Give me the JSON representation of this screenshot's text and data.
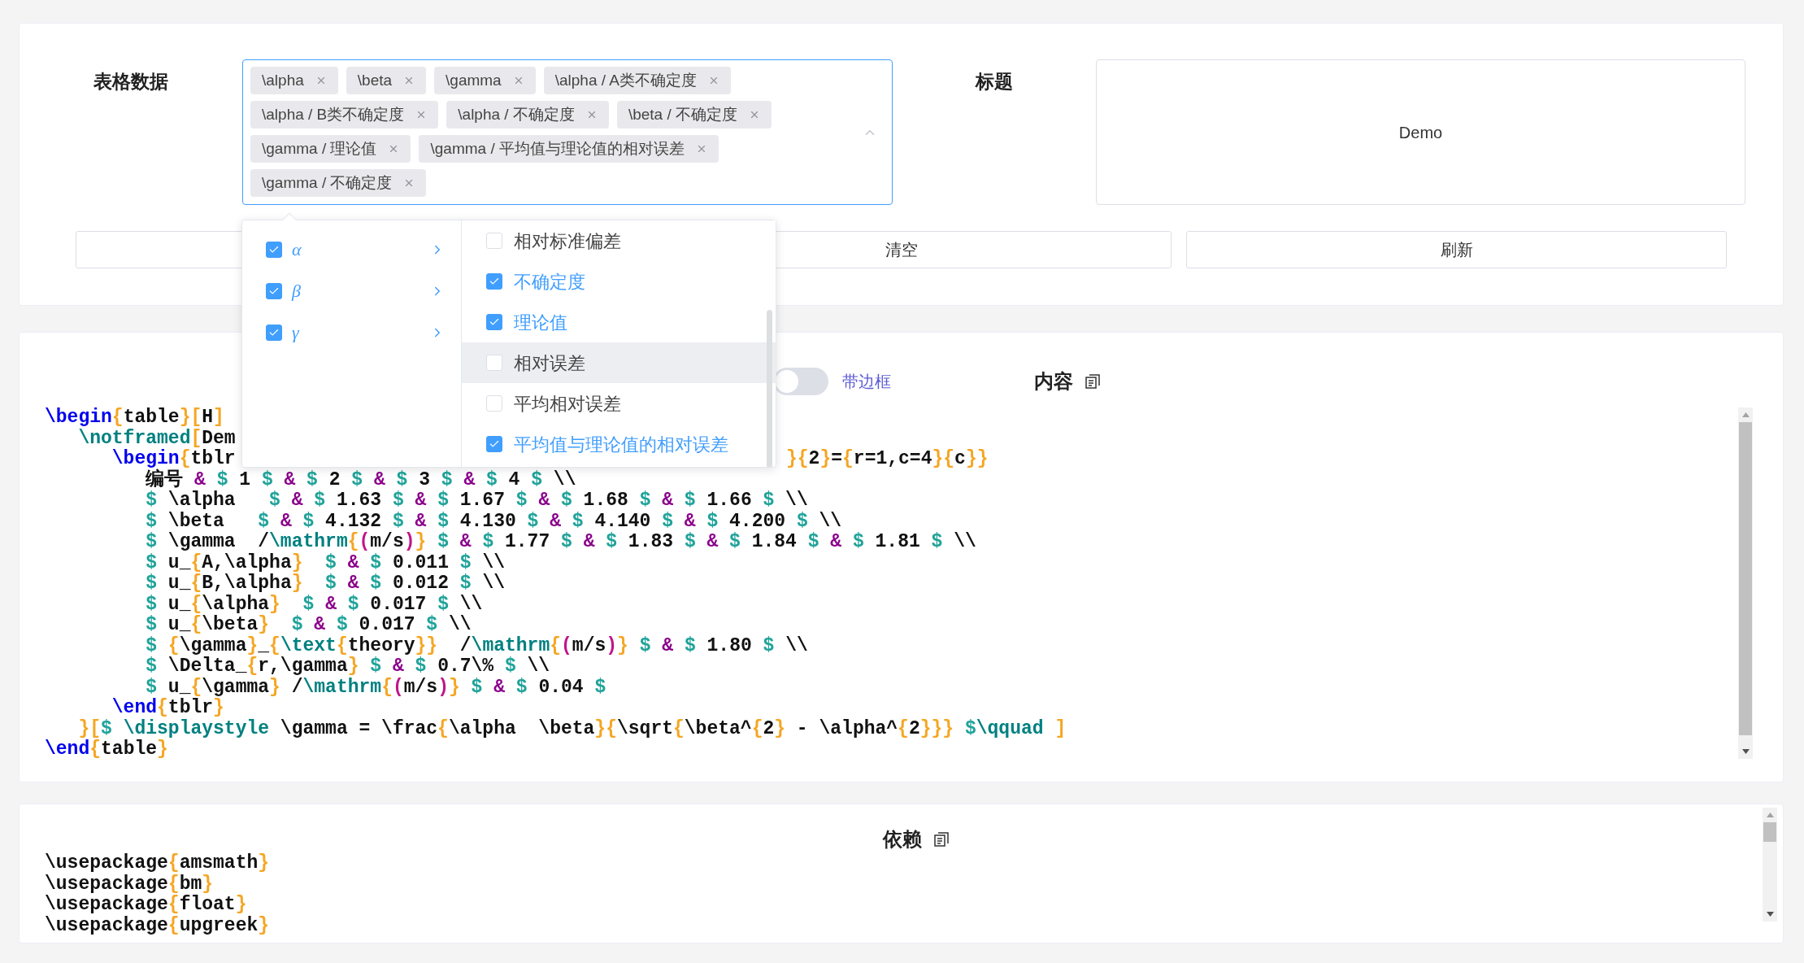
{
  "form": {
    "table_data": {
      "label": "表格数据",
      "tags": [
        "\\alpha",
        "\\beta",
        "\\gamma",
        "\\alpha / A类不确定度",
        "\\alpha / B类不确定度",
        "\\alpha / 不确定度",
        "\\beta / 不确定度",
        "\\gamma / 理论值",
        "\\gamma / 平均值与理论值的相对误差",
        "\\gamma / 不确定度"
      ]
    },
    "title": {
      "label": "标题",
      "value": "Demo"
    },
    "buttons": [
      {
        "label": "清空"
      },
      {
        "label": "刷新"
      }
    ]
  },
  "cascader": {
    "options": [
      {
        "label": "α",
        "checked": true
      },
      {
        "label": "β",
        "checked": true
      },
      {
        "label": "γ",
        "checked": true
      }
    ],
    "sub_options": [
      {
        "label": "相对标准偏差",
        "checked": false,
        "highlighted": false
      },
      {
        "label": "不确定度",
        "checked": true,
        "highlighted": false
      },
      {
        "label": "理论值",
        "checked": true,
        "highlighted": false
      },
      {
        "label": "相对误差",
        "checked": false,
        "highlighted": true
      },
      {
        "label": "平均相对误差",
        "checked": false,
        "highlighted": false
      },
      {
        "label": "平均值与理论值的相对误差",
        "checked": true,
        "highlighted": false
      }
    ]
  },
  "content": {
    "border_toggle": {
      "label": "带边框",
      "on": false
    },
    "heading": "内容",
    "lines": [
      {
        "segments": [
          {
            "kind": "keyword",
            "text": "\\begin"
          },
          {
            "kind": "brace",
            "text": "{"
          },
          {
            "kind": "plain",
            "text": "table"
          },
          {
            "kind": "brace",
            "text": "}["
          },
          {
            "kind": "plain",
            "text": "H"
          },
          {
            "kind": "brace",
            "text": "]"
          }
        ]
      },
      {
        "segments": [
          {
            "kind": "macro",
            "text": "   \\notframed"
          },
          {
            "kind": "brace",
            "text": "["
          },
          {
            "kind": "plain",
            "text": "Dem"
          }
        ]
      },
      {
        "segments": [
          {
            "kind": "keyword",
            "text": "      \\begin"
          },
          {
            "kind": "brace",
            "text": "{"
          },
          {
            "kind": "plain",
            "text": "tblr"
          }
        ],
        "tail": [
          {
            "kind": "brace",
            "text": "}{"
          },
          {
            "kind": "plain",
            "text": "2"
          },
          {
            "kind": "brace",
            "text": "}"
          },
          {
            "kind": "plain",
            "text": "="
          },
          {
            "kind": "brace",
            "text": "{"
          },
          {
            "kind": "plain",
            "text": "r=1,c=4"
          },
          {
            "kind": "brace",
            "text": "}{"
          },
          {
            "kind": "plain",
            "text": "c"
          },
          {
            "kind": "brace",
            "text": "}}"
          }
        ]
      },
      {
        "segments": [
          {
            "kind": "plain",
            "text": "         编号 "
          },
          {
            "kind": "amp",
            "text": "& "
          },
          {
            "kind": "dollar",
            "text": "$"
          },
          {
            "kind": "plain",
            "text": " 1 "
          },
          {
            "kind": "dollar",
            "text": "$ "
          },
          {
            "kind": "amp",
            "text": "& "
          },
          {
            "kind": "dollar",
            "text": "$"
          },
          {
            "kind": "plain",
            "text": " 2 "
          },
          {
            "kind": "dollar",
            "text": "$ "
          },
          {
            "kind": "amp",
            "text": "& "
          },
          {
            "kind": "dollar",
            "text": "$"
          },
          {
            "kind": "plain",
            "text": " 3 "
          },
          {
            "kind": "dollar",
            "text": "$ "
          },
          {
            "kind": "amp",
            "text": "& "
          },
          {
            "kind": "dollar",
            "text": "$"
          },
          {
            "kind": "plain",
            "text": " 4 "
          },
          {
            "kind": "dollar",
            "text": "$"
          },
          {
            "kind": "plain",
            "text": " \\\\"
          }
        ]
      },
      {
        "segments": [
          {
            "kind": "dollar",
            "text": "         $"
          },
          {
            "kind": "plain",
            "text": " \\alpha   "
          },
          {
            "kind": "dollar",
            "text": "$ "
          },
          {
            "kind": "amp",
            "text": "& "
          },
          {
            "kind": "dollar",
            "text": "$"
          },
          {
            "kind": "plain",
            "text": " 1.63 "
          },
          {
            "kind": "dollar",
            "text": "$ "
          },
          {
            "kind": "amp",
            "text": "& "
          },
          {
            "kind": "dollar",
            "text": "$"
          },
          {
            "kind": "plain",
            "text": " 1.67 "
          },
          {
            "kind": "dollar",
            "text": "$ "
          },
          {
            "kind": "amp",
            "text": "& "
          },
          {
            "kind": "dollar",
            "text": "$"
          },
          {
            "kind": "plain",
            "text": " 1.68 "
          },
          {
            "kind": "dollar",
            "text": "$ "
          },
          {
            "kind": "amp",
            "text": "& "
          },
          {
            "kind": "dollar",
            "text": "$"
          },
          {
            "kind": "plain",
            "text": " 1.66 "
          },
          {
            "kind": "dollar",
            "text": "$"
          },
          {
            "kind": "plain",
            "text": " \\\\"
          }
        ]
      },
      {
        "segments": [
          {
            "kind": "dollar",
            "text": "         $"
          },
          {
            "kind": "plain",
            "text": " \\beta   "
          },
          {
            "kind": "dollar",
            "text": "$ "
          },
          {
            "kind": "amp",
            "text": "& "
          },
          {
            "kind": "dollar",
            "text": "$"
          },
          {
            "kind": "plain",
            "text": " 4.132 "
          },
          {
            "kind": "dollar",
            "text": "$ "
          },
          {
            "kind": "amp",
            "text": "& "
          },
          {
            "kind": "dollar",
            "text": "$"
          },
          {
            "kind": "plain",
            "text": " 4.130 "
          },
          {
            "kind": "dollar",
            "text": "$ "
          },
          {
            "kind": "amp",
            "text": "& "
          },
          {
            "kind": "dollar",
            "text": "$"
          },
          {
            "kind": "plain",
            "text": " 4.140 "
          },
          {
            "kind": "dollar",
            "text": "$ "
          },
          {
            "kind": "amp",
            "text": "& "
          },
          {
            "kind": "dollar",
            "text": "$"
          },
          {
            "kind": "plain",
            "text": " 4.200 "
          },
          {
            "kind": "dollar",
            "text": "$"
          },
          {
            "kind": "plain",
            "text": " \\\\"
          }
        ]
      },
      {
        "segments": [
          {
            "kind": "dollar",
            "text": "         $"
          },
          {
            "kind": "plain",
            "text": " \\gamma  /"
          },
          {
            "kind": "macro",
            "text": "\\mathrm"
          },
          {
            "kind": "brace",
            "text": "{"
          },
          {
            "kind": "paren",
            "text": "("
          },
          {
            "kind": "plain",
            "text": "m/s"
          },
          {
            "kind": "paren",
            "text": ")"
          },
          {
            "kind": "brace",
            "text": "} "
          },
          {
            "kind": "dollar",
            "text": "$ "
          },
          {
            "kind": "amp",
            "text": "& "
          },
          {
            "kind": "dollar",
            "text": "$"
          },
          {
            "kind": "plain",
            "text": " 1.77 "
          },
          {
            "kind": "dollar",
            "text": "$ "
          },
          {
            "kind": "amp",
            "text": "& "
          },
          {
            "kind": "dollar",
            "text": "$"
          },
          {
            "kind": "plain",
            "text": " 1.83 "
          },
          {
            "kind": "dollar",
            "text": "$ "
          },
          {
            "kind": "amp",
            "text": "& "
          },
          {
            "kind": "dollar",
            "text": "$"
          },
          {
            "kind": "plain",
            "text": " 1.84 "
          },
          {
            "kind": "dollar",
            "text": "$ "
          },
          {
            "kind": "amp",
            "text": "& "
          },
          {
            "kind": "dollar",
            "text": "$"
          },
          {
            "kind": "plain",
            "text": " 1.81 "
          },
          {
            "kind": "dollar",
            "text": "$"
          },
          {
            "kind": "plain",
            "text": " \\\\"
          }
        ]
      },
      {
        "segments": [
          {
            "kind": "dollar",
            "text": "         $"
          },
          {
            "kind": "plain",
            "text": " u_"
          },
          {
            "kind": "brace",
            "text": "{"
          },
          {
            "kind": "plain",
            "text": "A,\\alpha"
          },
          {
            "kind": "brace",
            "text": "}  "
          },
          {
            "kind": "dollar",
            "text": "$ "
          },
          {
            "kind": "amp",
            "text": "& "
          },
          {
            "kind": "dollar",
            "text": "$"
          },
          {
            "kind": "plain",
            "text": " 0.011 "
          },
          {
            "kind": "dollar",
            "text": "$"
          },
          {
            "kind": "plain",
            "text": " \\\\"
          }
        ]
      },
      {
        "segments": [
          {
            "kind": "dollar",
            "text": "         $"
          },
          {
            "kind": "plain",
            "text": " u_"
          },
          {
            "kind": "brace",
            "text": "{"
          },
          {
            "kind": "plain",
            "text": "B,\\alpha"
          },
          {
            "kind": "brace",
            "text": "}  "
          },
          {
            "kind": "dollar",
            "text": "$ "
          },
          {
            "kind": "amp",
            "text": "& "
          },
          {
            "kind": "dollar",
            "text": "$"
          },
          {
            "kind": "plain",
            "text": " 0.012 "
          },
          {
            "kind": "dollar",
            "text": "$"
          },
          {
            "kind": "plain",
            "text": " \\\\"
          }
        ]
      },
      {
        "segments": [
          {
            "kind": "dollar",
            "text": "         $"
          },
          {
            "kind": "plain",
            "text": " u_"
          },
          {
            "kind": "brace",
            "text": "{"
          },
          {
            "kind": "plain",
            "text": "\\alpha"
          },
          {
            "kind": "brace",
            "text": "}  "
          },
          {
            "kind": "dollar",
            "text": "$ "
          },
          {
            "kind": "amp",
            "text": "& "
          },
          {
            "kind": "dollar",
            "text": "$"
          },
          {
            "kind": "plain",
            "text": " 0.017 "
          },
          {
            "kind": "dollar",
            "text": "$"
          },
          {
            "kind": "plain",
            "text": " \\\\"
          }
        ]
      },
      {
        "segments": [
          {
            "kind": "dollar",
            "text": "         $"
          },
          {
            "kind": "plain",
            "text": " u_"
          },
          {
            "kind": "brace",
            "text": "{"
          },
          {
            "kind": "plain",
            "text": "\\beta"
          },
          {
            "kind": "brace",
            "text": "}  "
          },
          {
            "kind": "dollar",
            "text": "$ "
          },
          {
            "kind": "amp",
            "text": "& "
          },
          {
            "kind": "dollar",
            "text": "$"
          },
          {
            "kind": "plain",
            "text": " 0.017 "
          },
          {
            "kind": "dollar",
            "text": "$"
          },
          {
            "kind": "plain",
            "text": " \\\\"
          }
        ]
      },
      {
        "segments": [
          {
            "kind": "dollar",
            "text": "         $ "
          },
          {
            "kind": "brace",
            "text": "{"
          },
          {
            "kind": "plain",
            "text": "\\gamma"
          },
          {
            "kind": "brace",
            "text": "}"
          },
          {
            "kind": "plain",
            "text": "_"
          },
          {
            "kind": "brace",
            "text": "{"
          },
          {
            "kind": "macro",
            "text": "\\text"
          },
          {
            "kind": "brace",
            "text": "{"
          },
          {
            "kind": "plain",
            "text": "theory"
          },
          {
            "kind": "brace",
            "text": "}}"
          },
          {
            "kind": "plain",
            "text": "  /"
          },
          {
            "kind": "macro",
            "text": "\\mathrm"
          },
          {
            "kind": "brace",
            "text": "{"
          },
          {
            "kind": "paren",
            "text": "("
          },
          {
            "kind": "plain",
            "text": "m/s"
          },
          {
            "kind": "paren",
            "text": ")"
          },
          {
            "kind": "brace",
            "text": "} "
          },
          {
            "kind": "dollar",
            "text": "$ "
          },
          {
            "kind": "amp",
            "text": "& "
          },
          {
            "kind": "dollar",
            "text": "$"
          },
          {
            "kind": "plain",
            "text": " 1.80 "
          },
          {
            "kind": "dollar",
            "text": "$"
          },
          {
            "kind": "plain",
            "text": " \\\\"
          }
        ]
      },
      {
        "segments": [
          {
            "kind": "dollar",
            "text": "         $"
          },
          {
            "kind": "plain",
            "text": " \\Delta_"
          },
          {
            "kind": "brace",
            "text": "{"
          },
          {
            "kind": "plain",
            "text": "r,\\gamma"
          },
          {
            "kind": "brace",
            "text": "} "
          },
          {
            "kind": "dollar",
            "text": "$ "
          },
          {
            "kind": "amp",
            "text": "& "
          },
          {
            "kind": "dollar",
            "text": "$"
          },
          {
            "kind": "plain",
            "text": " 0.7\\% "
          },
          {
            "kind": "dollar",
            "text": "$"
          },
          {
            "kind": "plain",
            "text": " \\\\"
          }
        ]
      },
      {
        "segments": [
          {
            "kind": "dollar",
            "text": "         $"
          },
          {
            "kind": "plain",
            "text": " u_"
          },
          {
            "kind": "brace",
            "text": "{"
          },
          {
            "kind": "plain",
            "text": "\\gamma"
          },
          {
            "kind": "brace",
            "text": "}"
          },
          {
            "kind": "plain",
            "text": " /"
          },
          {
            "kind": "macro",
            "text": "\\mathrm"
          },
          {
            "kind": "brace",
            "text": "{"
          },
          {
            "kind": "paren",
            "text": "("
          },
          {
            "kind": "plain",
            "text": "m/s"
          },
          {
            "kind": "paren",
            "text": ")"
          },
          {
            "kind": "brace",
            "text": "} "
          },
          {
            "kind": "dollar",
            "text": "$ "
          },
          {
            "kind": "amp",
            "text": "& "
          },
          {
            "kind": "dollar",
            "text": "$"
          },
          {
            "kind": "plain",
            "text": " 0.04 "
          },
          {
            "kind": "dollar",
            "text": "$"
          }
        ]
      },
      {
        "segments": [
          {
            "kind": "keyword",
            "text": "      \\end"
          },
          {
            "kind": "brace",
            "text": "{"
          },
          {
            "kind": "plain",
            "text": "tblr"
          },
          {
            "kind": "brace",
            "text": "}"
          }
        ]
      },
      {
        "segments": [
          {
            "kind": "brace",
            "text": "   }["
          },
          {
            "kind": "dollar",
            "text": "$ "
          },
          {
            "kind": "macro",
            "text": "\\displaystyle"
          },
          {
            "kind": "plain",
            "text": " \\gamma = \\frac"
          },
          {
            "kind": "brace",
            "text": "{"
          },
          {
            "kind": "plain",
            "text": "\\alpha  \\beta"
          },
          {
            "kind": "brace",
            "text": "}{"
          },
          {
            "kind": "plain",
            "text": "\\sqrt"
          },
          {
            "kind": "brace",
            "text": "{"
          },
          {
            "kind": "plain",
            "text": "\\beta^"
          },
          {
            "kind": "brace",
            "text": "{"
          },
          {
            "kind": "plain",
            "text": "2"
          },
          {
            "kind": "brace",
            "text": "}"
          },
          {
            "kind": "plain",
            "text": " - \\alpha^"
          },
          {
            "kind": "brace",
            "text": "{"
          },
          {
            "kind": "plain",
            "text": "2"
          },
          {
            "kind": "brace",
            "text": "}}} "
          },
          {
            "kind": "dollar",
            "text": "$"
          },
          {
            "kind": "macro",
            "text": "\\qquad "
          },
          {
            "kind": "brace",
            "text": "]"
          }
        ]
      },
      {
        "segments": [
          {
            "kind": "keyword",
            "text": "\\end"
          },
          {
            "kind": "brace",
            "text": "{"
          },
          {
            "kind": "plain",
            "text": "table"
          },
          {
            "kind": "brace",
            "text": "}"
          }
        ]
      }
    ]
  },
  "dependencies": {
    "heading": "依赖",
    "lines": [
      {
        "segments": [
          {
            "kind": "plain",
            "text": "\\usepackage"
          },
          {
            "kind": "brace",
            "text": "{"
          },
          {
            "kind": "plain",
            "text": "amsmath"
          },
          {
            "kind": "brace",
            "text": "}"
          }
        ]
      },
      {
        "segments": [
          {
            "kind": "plain",
            "text": "\\usepackage"
          },
          {
            "kind": "brace",
            "text": "{"
          },
          {
            "kind": "plain",
            "text": "bm"
          },
          {
            "kind": "brace",
            "text": "}"
          }
        ]
      },
      {
        "segments": [
          {
            "kind": "plain",
            "text": "\\usepackage"
          },
          {
            "kind": "brace",
            "text": "{"
          },
          {
            "kind": "plain",
            "text": "float"
          },
          {
            "kind": "brace",
            "text": "}"
          }
        ]
      },
      {
        "segments": [
          {
            "kind": "plain",
            "text": "\\usepackage"
          },
          {
            "kind": "brace",
            "text": "{"
          },
          {
            "kind": "plain",
            "text": "upgreek"
          },
          {
            "kind": "brace",
            "text": "}"
          }
        ]
      }
    ]
  }
}
